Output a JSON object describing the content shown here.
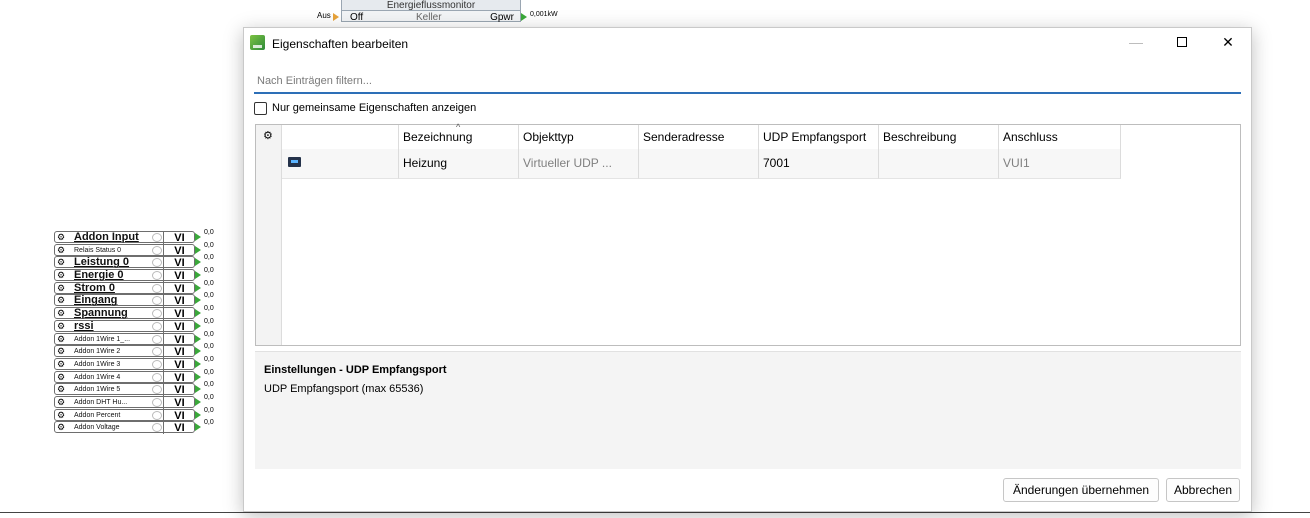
{
  "background": {
    "energy_monitor": {
      "input_label": "Aus",
      "title": "Energieflussmonitor",
      "state": "Off",
      "location": "Keller",
      "output_label": "Gpwr",
      "output_value": "0,001kW"
    },
    "addon_items": [
      {
        "name": "Addon Input",
        "type": "VI",
        "value": "0,0",
        "big": true
      },
      {
        "name": "Relais Status 0",
        "type": "VI",
        "value": "0,0",
        "big": false
      },
      {
        "name": "Leistung 0",
        "type": "VI",
        "value": "0,0",
        "big": true
      },
      {
        "name": "Energie 0",
        "type": "VI",
        "value": "0,0",
        "big": true
      },
      {
        "name": "Strom 0",
        "type": "VI",
        "value": "0,0",
        "big": true
      },
      {
        "name": "Eingang",
        "type": "VI",
        "value": "0,0",
        "big": true
      },
      {
        "name": "Spannung",
        "type": "VI",
        "value": "0,0",
        "big": true
      },
      {
        "name": "rssi",
        "type": "VI",
        "value": "0,0",
        "big": true
      },
      {
        "name": "Addon 1Wire 1_...",
        "type": "VI",
        "value": "0,0",
        "big": false
      },
      {
        "name": "Addon 1Wire 2",
        "type": "VI",
        "value": "0,0",
        "big": false
      },
      {
        "name": "Addon 1Wire 3",
        "type": "VI",
        "value": "0,0",
        "big": false
      },
      {
        "name": "Addon 1Wire 4",
        "type": "VI",
        "value": "0,0",
        "big": false
      },
      {
        "name": "Addon 1Wire 5",
        "type": "VI",
        "value": "0,0",
        "big": false
      },
      {
        "name": "Addon DHT Hu...",
        "type": "VI",
        "value": "0,0",
        "big": false
      },
      {
        "name": "Addon Percent",
        "type": "VI",
        "value": "0,0",
        "big": false
      },
      {
        "name": "Addon Voltage",
        "type": "VI",
        "value": "0,0",
        "big": false
      }
    ]
  },
  "dialog": {
    "title": "Eigenschaften bearbeiten",
    "window_buttons": {
      "minimize": "—",
      "close": "✕"
    },
    "filter_placeholder": "Nach Einträgen filtern...",
    "common_only_label": "Nur gemeinsame Eigenschaften anzeigen",
    "common_only_checked": false,
    "columns": [
      "",
      "Bezeichnung",
      "Objekttyp",
      "Senderadresse",
      "UDP Empfangsport",
      "Beschreibung",
      "Anschluss"
    ],
    "rows": [
      {
        "icon": "udp-receiver-icon",
        "Bezeichnung": "Heizung",
        "Objekttyp": "Virtueller UDP ...",
        "Senderadresse": "",
        "UDP Empfangsport": "7001",
        "Beschreibung": "",
        "Anschluss": "VUI1"
      }
    ],
    "details": {
      "title": "Einstellungen - UDP Empfangsport",
      "text": "UDP Empfangsport (max 65536)"
    },
    "buttons": {
      "apply": "Änderungen übernehmen",
      "cancel": "Abbrechen"
    }
  },
  "colors": {
    "accent": "#2d6fb7",
    "pin_green": "#3aa83a",
    "pin_orange": "#e8a33a"
  }
}
